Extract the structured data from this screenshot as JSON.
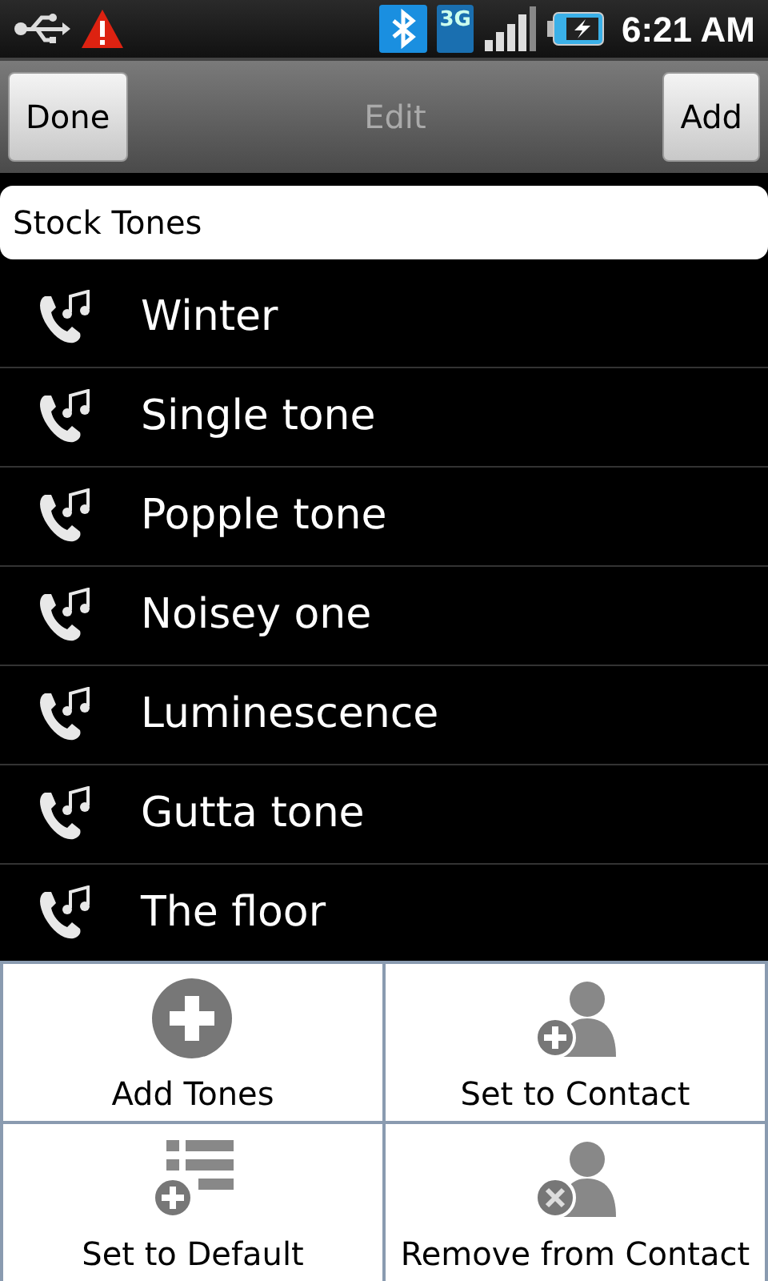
{
  "status_bar": {
    "network_type": "3G",
    "time": "6:21 AM"
  },
  "title_bar": {
    "left_button": "Done",
    "title": "Edit",
    "right_button": "Add"
  },
  "section_header": "Stock Tones",
  "tones": [
    {
      "name": "Winter"
    },
    {
      "name": "Single tone"
    },
    {
      "name": "Popple tone"
    },
    {
      "name": "Noisey one"
    },
    {
      "name": "Luminescence"
    },
    {
      "name": "Gutta tone"
    },
    {
      "name": "The floor"
    }
  ],
  "menu": [
    {
      "label": "Add Tones",
      "kind": "add"
    },
    {
      "label": "Set to Contact",
      "kind": "contact-add"
    },
    {
      "label": "Set to Default",
      "kind": "list-add"
    },
    {
      "label": "Remove from Contact",
      "kind": "contact-remove"
    }
  ]
}
